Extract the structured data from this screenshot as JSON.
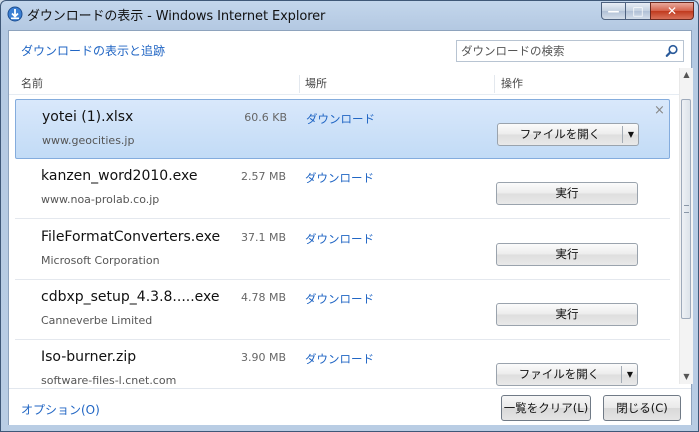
{
  "window": {
    "title": "ダウンロードの表示 - Windows Internet Explorer",
    "min_glyph": "—",
    "max_glyph": "□",
    "close_glyph": "✕"
  },
  "header": {
    "link": "ダウンロードの表示と追跡",
    "search_placeholder": "ダウンロードの検索"
  },
  "columns": {
    "name": "名前",
    "location": "場所",
    "action": "操作"
  },
  "items": [
    {
      "name": "yotei (1).xlsx",
      "source": "www.geocities.jp",
      "size": "60.6 KB",
      "location": "ダウンロード",
      "action": "ファイルを開く",
      "split": true,
      "selected": true,
      "close": "×"
    },
    {
      "name": "kanzen_word2010.exe",
      "source": "www.noa-prolab.co.jp",
      "size": "2.57 MB",
      "location": "ダウンロード",
      "action": "実行",
      "split": false,
      "selected": false
    },
    {
      "name": "FileFormatConverters.exe",
      "source": "Microsoft Corporation",
      "size": "37.1 MB",
      "location": "ダウンロード",
      "action": "実行",
      "split": false,
      "selected": false
    },
    {
      "name": "cdbxp_setup_4.3.8.....exe",
      "source": "Canneverbe Limited",
      "size": "4.78 MB",
      "location": "ダウンロード",
      "action": "実行",
      "split": false,
      "selected": false
    },
    {
      "name": "Iso-burner.zip",
      "source": "software-files-l.cnet.com",
      "size": "3.90 MB",
      "location": "ダウンロード",
      "action": "ファイルを開く",
      "split": true,
      "selected": false
    }
  ],
  "footer": {
    "options": "オプション(O)",
    "clear_list": "一覧をクリア(L)",
    "close": "閉じる(C)"
  },
  "colors": {
    "link": "#2166c4",
    "selection": "#c2dbf6"
  },
  "icons": {
    "title": "ie-download-icon",
    "search": "magnifier-icon",
    "dropdown": "chevron-down-icon",
    "remove": "close-icon"
  }
}
